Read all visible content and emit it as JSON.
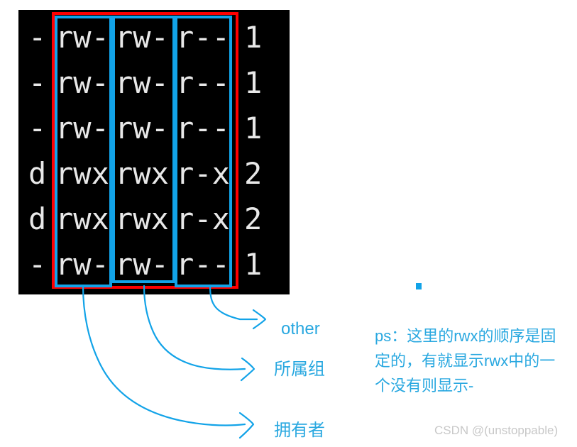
{
  "terminal": {
    "background": "#000000",
    "text_color": "#e8e8e8",
    "rows": [
      {
        "type": "-",
        "owner": "rw-",
        "group": "rw-",
        "other": "r--",
        "links": "1"
      },
      {
        "type": "-",
        "owner": "rw-",
        "group": "rw-",
        "other": "r--",
        "links": "1"
      },
      {
        "type": "-",
        "owner": "rw-",
        "group": "rw-",
        "other": "r--",
        "links": "1"
      },
      {
        "type": "d",
        "owner": "rwx",
        "group": "rwx",
        "other": "r-x",
        "links": "2"
      },
      {
        "type": "d",
        "owner": "rwx",
        "group": "rwx",
        "other": "r-x",
        "links": "2"
      },
      {
        "type": "-",
        "owner": "rw-",
        "group": "rw-",
        "other": "r--",
        "links": "1"
      }
    ]
  },
  "annotations": {
    "red_box_color": "#fe0000",
    "blue_box_color": "#12a3e8",
    "callouts": [
      {
        "label": "other",
        "name": "other"
      },
      {
        "label": "所属组",
        "name": "group"
      },
      {
        "label": "拥有者",
        "name": "owner"
      }
    ]
  },
  "note": {
    "text": "ps：这里的rwx的顺序是固定的，有就显示rwx中的一个没有则显示-",
    "color": "#29a8e0"
  },
  "watermark": {
    "text": "CSDN @(unstoppable)",
    "color": "#c8c8c8"
  }
}
